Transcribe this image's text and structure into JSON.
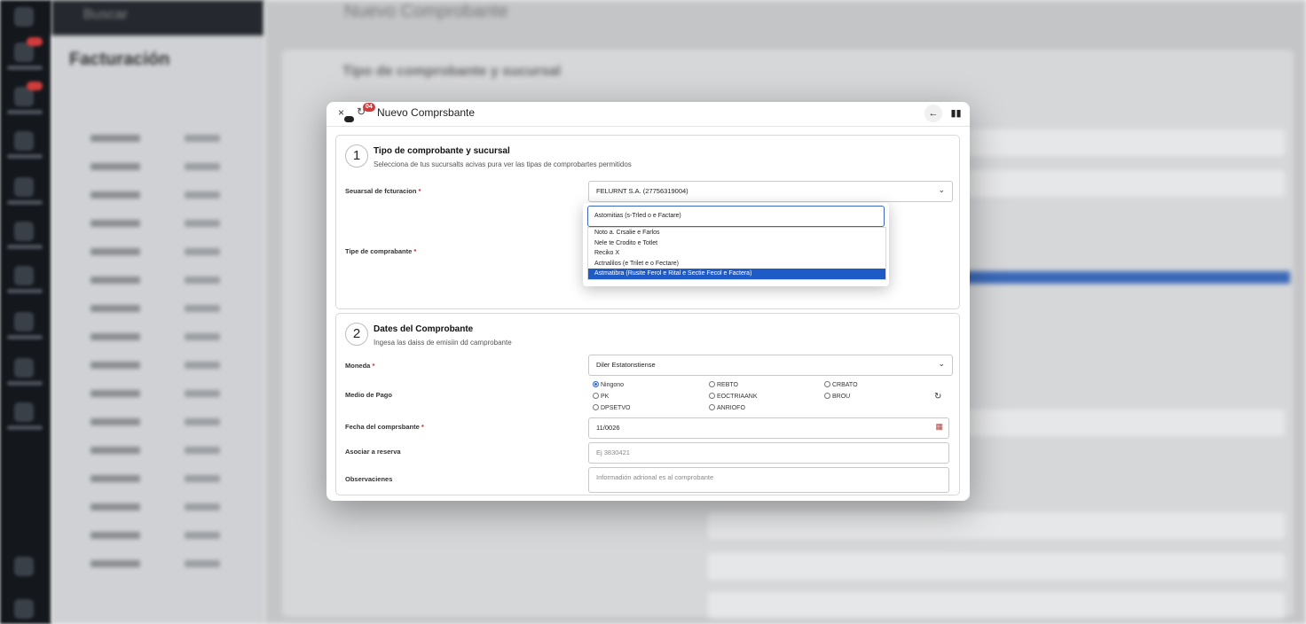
{
  "background": {
    "search_placeholder": "Buscar",
    "section_title": "Facturación",
    "main_title": "Nuevo Comprobante",
    "step_title": "Tipo de comprobante y sucursal"
  },
  "modal": {
    "title": "Nuevo Comprsbante",
    "close_icon": "×",
    "refresh_icon": "↻",
    "count_badge": "04",
    "back_icon": "←",
    "book_icon": "▮▮"
  },
  "section1": {
    "number": "1",
    "title": "Tipo de comprobante y sucursal",
    "subtitle": "Selecciona de tus sucursalts acivas pura ver las tipas de comprobartes permitidos",
    "sucursal_label": "Seuarsal de fcturacion",
    "sucursal_value": "FELURNT S.A. (27756319004)",
    "tipo_label": "Tipe de comprabante",
    "required_mark": "*"
  },
  "dropdown": {
    "search_value": "Astomitias (s-Trled o e Factare)",
    "options": [
      "Noto a. Crsalie e Farlos",
      "Nele te Crodito e Totlet",
      "Reciko X",
      "Actnalilos (e Trilet e o Fectare)",
      "Astmatibra (Rusite Ferol e Rital e Sectie Fecol e Factera)"
    ],
    "selected_index": 4
  },
  "section2": {
    "number": "2",
    "title": "Dates del Comprobante",
    "subtitle": "Ingesa las daiss de emisiin dd camprobante",
    "moneda_label": "Moneda",
    "moneda_value": "Diler Estatonstiense",
    "medio_label": "Medio de Pago",
    "payment_options": [
      {
        "label": "Ningono",
        "selected": true
      },
      {
        "label": "REBTO",
        "selected": false
      },
      {
        "label": "CRBATO",
        "selected": false
      },
      {
        "label": "PK",
        "selected": false
      },
      {
        "label": "EOCTRIAANK",
        "selected": false
      },
      {
        "label": "BROU",
        "selected": false
      },
      {
        "label": "DPSETVO",
        "selected": false
      },
      {
        "label": "ANRIOFO",
        "selected": false
      }
    ],
    "reload_icon": "↻",
    "fecha_label": "Fecha del comprsbante",
    "fecha_value": "11/0026",
    "calendar_icon": "▦",
    "asociar_label": "Asociar a reserva",
    "asociar_placeholder": "Ej 3830421",
    "obs_label": "Observacienes",
    "obs_placeholder": "Informadión adrional es al comprobante"
  }
}
